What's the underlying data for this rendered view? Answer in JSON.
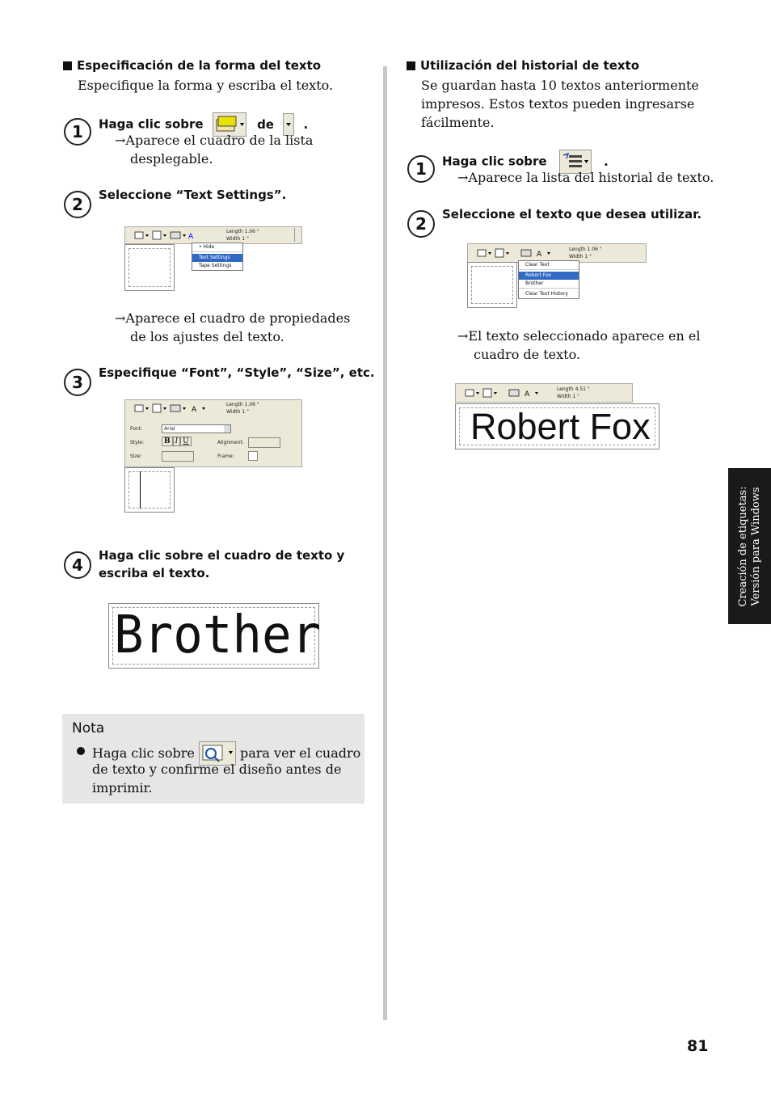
{
  "left": {
    "section_title": "Especificación de la forma del texto",
    "section_intro": "Especifique la forma y escriba el texto.",
    "step1": {
      "num": "1",
      "text_a": "Haga clic sobre",
      "text_b": "de",
      "text_c": ".",
      "result": "→Aparece el cuadro de la lista",
      "result2": "desplegable."
    },
    "step2": {
      "num": "2",
      "text": "Seleccione “Text Settings”.",
      "menu": [
        "Hide",
        "Text Settings",
        "Tape Settings"
      ],
      "length": "Length 1.06 \"",
      "width": "Width 1 \"",
      "result": "→Aparece el cuadro de propiedades",
      "result2": "de los ajustes del texto."
    },
    "step3": {
      "num": "3",
      "text": "Especifique “Font”, “Style”, “Size”, etc.",
      "font_label": "Font:",
      "font_value": "Arial",
      "style_label": "Style:",
      "size_label": "Size:",
      "alignment_label": "Alignment:",
      "frame_label": "Frame:",
      "bold": "B",
      "italic": "I",
      "underline": "U",
      "length": "Length 1.06 \"",
      "width": "Width 1 \""
    },
    "step4": {
      "num": "4",
      "text": "Haga clic sobre el cuadro de texto y",
      "text2": "escriba el texto.",
      "sample": "Brother"
    },
    "nota": {
      "title": "Nota",
      "text_a": "Haga clic sobre",
      "text_b": "para ver el cuadro",
      "text_c": "de texto y confirme el diseño antes de",
      "text_d": "imprimir."
    }
  },
  "right": {
    "section_title": "Utilización del historial de texto",
    "intro1": "Se guardan hasta 10 textos anteriormente",
    "intro2": "impresos. Estos textos pueden ingresarse",
    "intro3": "fácilmente.",
    "step1": {
      "num": "1",
      "text_a": "Haga clic sobre",
      "text_b": ".",
      "result": "→Aparece la lista del historial de texto."
    },
    "step2": {
      "num": "2",
      "text": "Seleccione el texto que desea utilizar.",
      "menu": [
        "Clear Text",
        "Robert Fox",
        "Brother",
        "Clear Text History"
      ],
      "length": "Length 1.06 \"",
      "width": "Width 1 \"",
      "result": "→El texto seleccionado aparece en el",
      "result2": "cuadro de texto."
    },
    "final": {
      "length": "Length 4.51 \"",
      "width": "Width 1 \"",
      "sample": "Robert Fox"
    }
  },
  "side_tab": {
    "line1": "Creación de etiquetas:",
    "line2": "Versión para Windows"
  },
  "page_number": "81"
}
